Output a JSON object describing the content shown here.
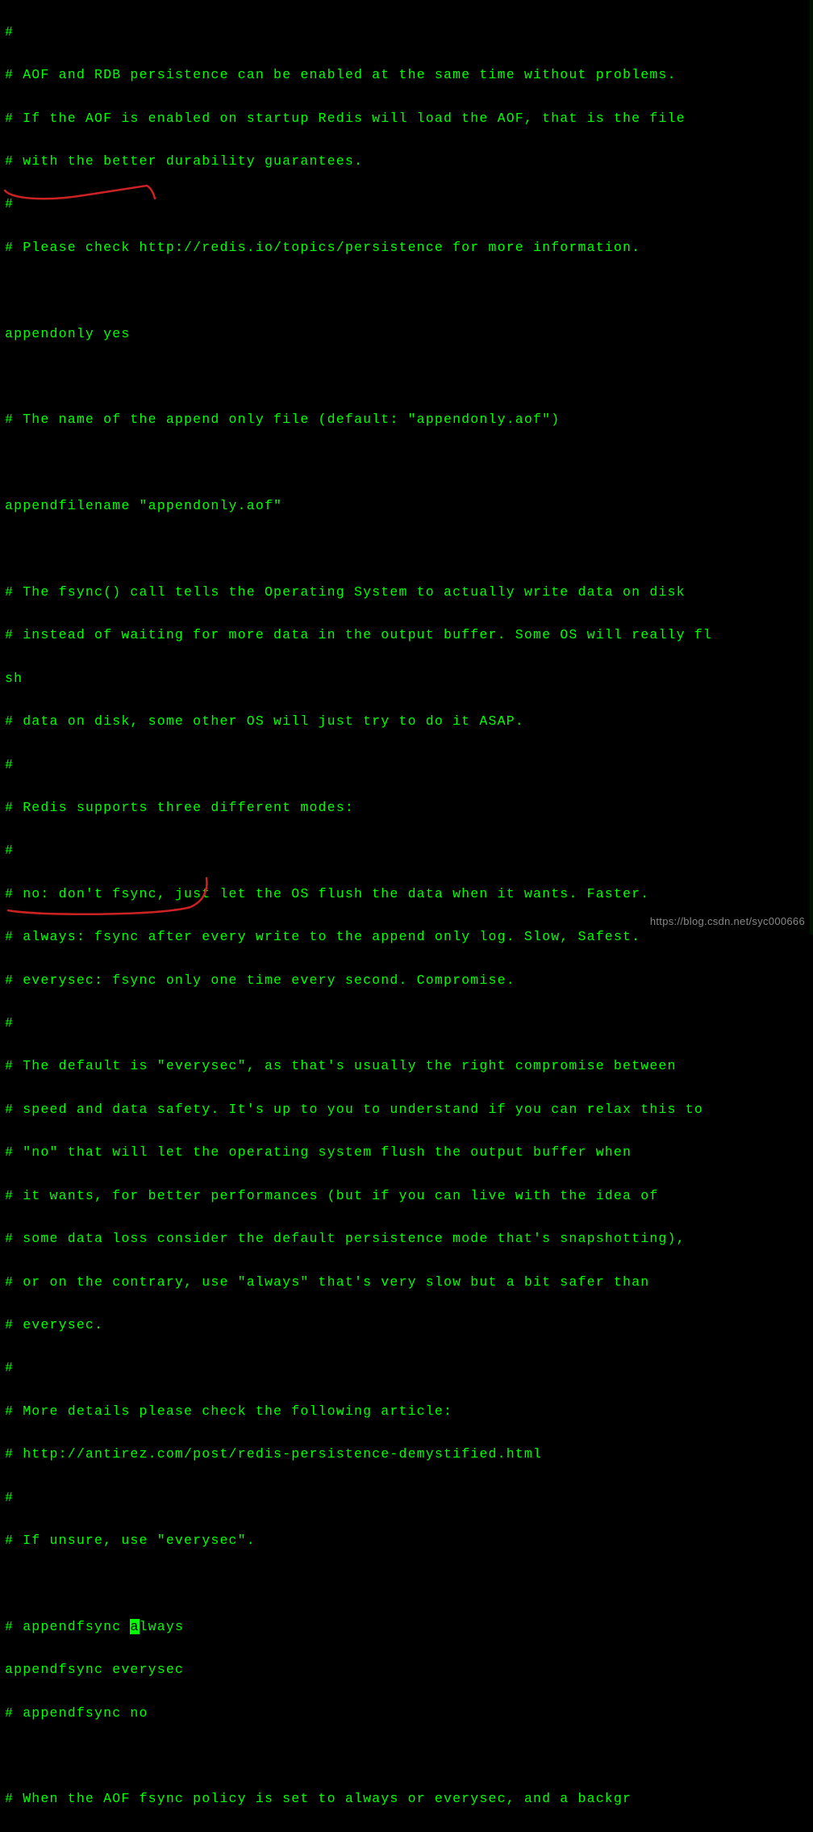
{
  "lines": {
    "l0": "#",
    "l1": "# AOF and RDB persistence can be enabled at the same time without problems.",
    "l2": "# If the AOF is enabled on startup Redis will load the AOF, that is the file",
    "l3": "# with the better durability guarantees.",
    "l4": "#",
    "l5": "# Please check http://redis.io/topics/persistence for more information.",
    "l6": "",
    "l7": "appendonly yes",
    "l8": "",
    "l9": "# The name of the append only file (default: \"appendonly.aof\")",
    "l10": "",
    "l11": "appendfilename \"appendonly.aof\"",
    "l12": "",
    "l13": "# The fsync() call tells the Operating System to actually write data on disk",
    "l14": "# instead of waiting for more data in the output buffer. Some OS will really fl",
    "l15": "sh",
    "l16": "# data on disk, some other OS will just try to do it ASAP.",
    "l17": "#",
    "l18": "# Redis supports three different modes:",
    "l19": "#",
    "l20": "# no: don't fsync, just let the OS flush the data when it wants. Faster.",
    "l21": "# always: fsync after every write to the append only log. Slow, Safest.",
    "l22": "# everysec: fsync only one time every second. Compromise.",
    "l23": "#",
    "l24": "# The default is \"everysec\", as that's usually the right compromise between",
    "l25": "# speed and data safety. It's up to you to understand if you can relax this to",
    "l26": "# \"no\" that will let the operating system flush the output buffer when",
    "l27": "# it wants, for better performances (but if you can live with the idea of",
    "l28": "# some data loss consider the default persistence mode that's snapshotting),",
    "l29": "# or on the contrary, use \"always\" that's very slow but a bit safer than",
    "l30": "# everysec.",
    "l31": "#",
    "l32": "# More details please check the following article:",
    "l33": "# http://antirez.com/post/redis-persistence-demystified.html",
    "l34": "#",
    "l35": "# If unsure, use \"everysec\".",
    "l36": "",
    "l37a": "# appendfsync ",
    "l37b": "a",
    "l37c": "lways",
    "l38": "appendfsync everysec",
    "l39": "# appendfsync no",
    "l40": "",
    "l41": "# When the AOF fsync policy is set to always or everysec, and a backgr"
  },
  "watermark": "https://blog.csdn.net/syc000666"
}
